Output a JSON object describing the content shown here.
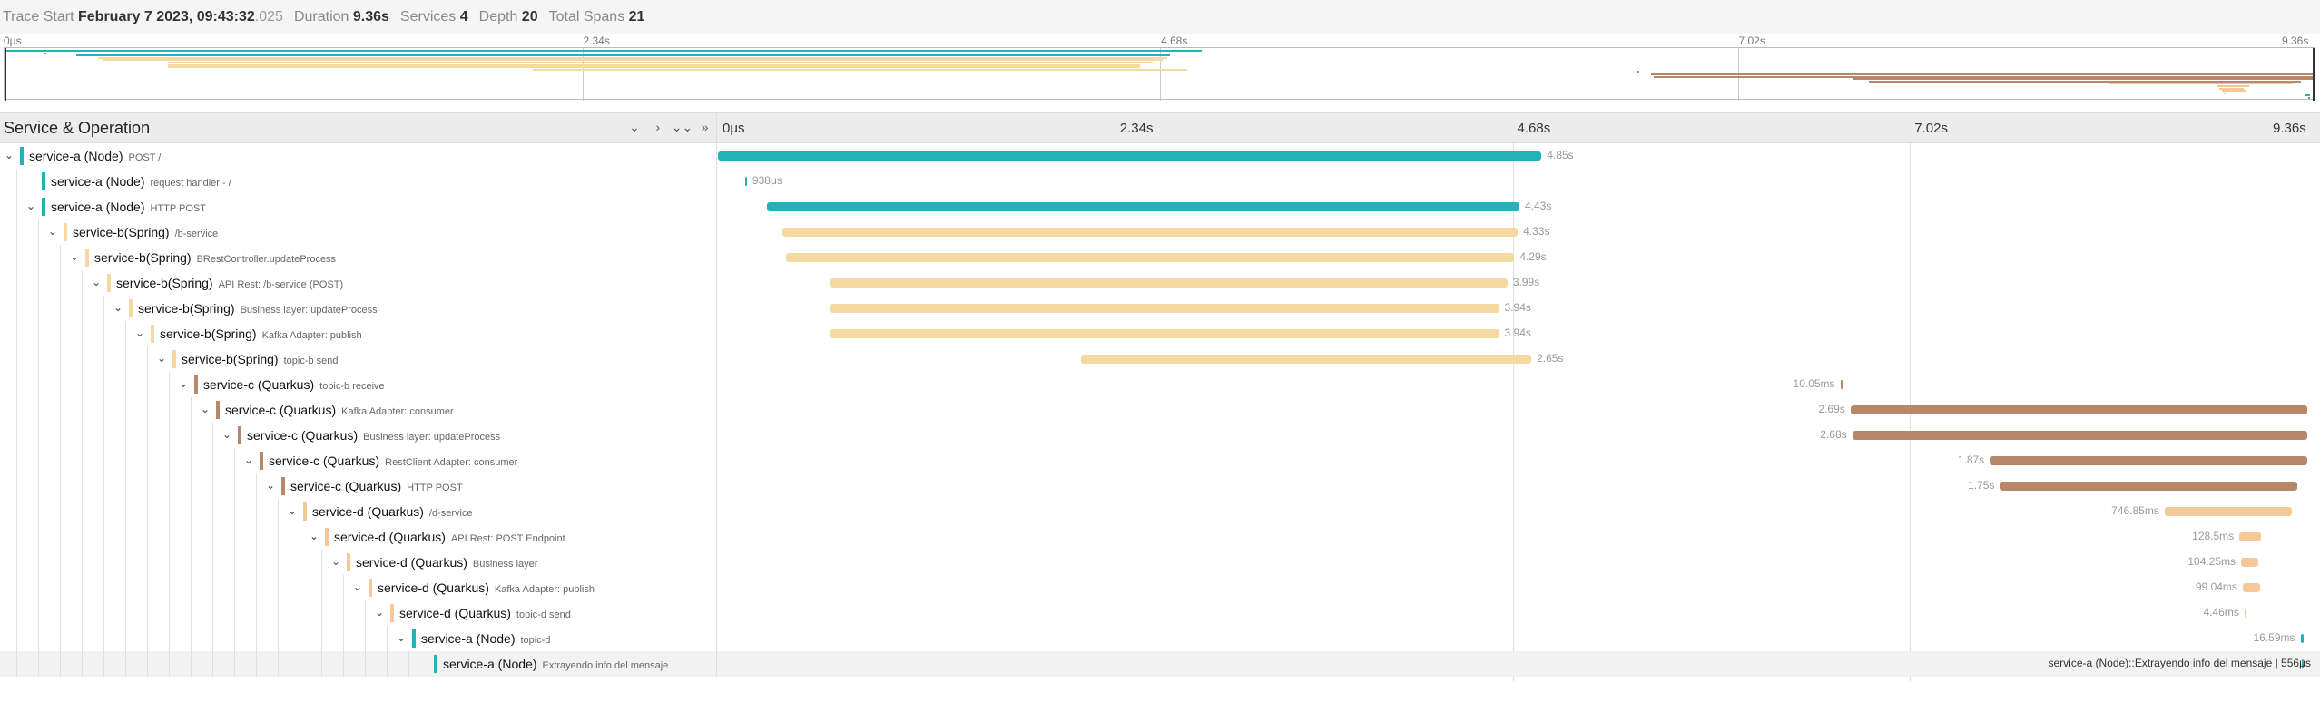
{
  "header": {
    "trace_start_label": "Trace Start",
    "trace_start_value": "February 7 2023, 09:43:32",
    "trace_start_ms": ".025",
    "duration_label": "Duration",
    "duration_value": "9.36s",
    "services_label": "Services",
    "services_value": "4",
    "depth_label": "Depth",
    "depth_value": "20",
    "spans_label": "Total Spans",
    "spans_value": "21"
  },
  "ticks": [
    "0μs",
    "2.34s",
    "4.68s",
    "7.02s",
    "9.36s"
  ],
  "table_head": {
    "title": "Service & Operation",
    "controls": [
      "⌄",
      "›",
      "⌄⌄",
      "»"
    ]
  },
  "colors": {
    "service-a": "#25b1b8",
    "service-b": "#f6d9a1",
    "service-c": "#b8876a",
    "service-d": "#f5c997"
  },
  "spans": [
    {
      "service": "service-a (Node)",
      "op": "POST /",
      "svc_key": "service-a",
      "depth": 0,
      "toggle": true,
      "start_s": 0.0,
      "dur_s": 4.85,
      "dur_label": "4.85s",
      "label_side": "right"
    },
    {
      "service": "service-a (Node)",
      "op": "request handler - /",
      "svc_key": "service-a",
      "depth": 1,
      "toggle": false,
      "start_s": 0.16,
      "dur_s": 0.0009,
      "dur_label": "938μs",
      "label_side": "right"
    },
    {
      "service": "service-a (Node)",
      "op": "HTTP POST",
      "svc_key": "service-a",
      "depth": 1,
      "toggle": true,
      "start_s": 0.29,
      "dur_s": 4.43,
      "dur_label": "4.43s",
      "label_side": "right"
    },
    {
      "service": "service-b(Spring)",
      "op": "/b-service",
      "svc_key": "service-b",
      "depth": 2,
      "toggle": true,
      "start_s": 0.38,
      "dur_s": 4.33,
      "dur_label": "4.33s",
      "label_side": "right"
    },
    {
      "service": "service-b(Spring)",
      "op": "BRestController.updateProcess",
      "svc_key": "service-b",
      "depth": 3,
      "toggle": true,
      "start_s": 0.4,
      "dur_s": 4.29,
      "dur_label": "4.29s",
      "label_side": "right"
    },
    {
      "service": "service-b(Spring)",
      "op": "API Rest: /b-service (POST)",
      "svc_key": "service-b",
      "depth": 4,
      "toggle": true,
      "start_s": 0.66,
      "dur_s": 3.99,
      "dur_label": "3.99s",
      "label_side": "right"
    },
    {
      "service": "service-b(Spring)",
      "op": "Business layer: updateProcess",
      "svc_key": "service-b",
      "depth": 5,
      "toggle": true,
      "start_s": 0.66,
      "dur_s": 3.94,
      "dur_label": "3.94s",
      "label_side": "right"
    },
    {
      "service": "service-b(Spring)",
      "op": "Kafka Adapter: publish",
      "svc_key": "service-b",
      "depth": 6,
      "toggle": true,
      "start_s": 0.66,
      "dur_s": 3.94,
      "dur_label": "3.94s",
      "label_side": "right"
    },
    {
      "service": "service-b(Spring)",
      "op": "topic-b send",
      "svc_key": "service-b",
      "depth": 7,
      "toggle": true,
      "start_s": 2.14,
      "dur_s": 2.65,
      "dur_label": "2.65s",
      "label_side": "right"
    },
    {
      "service": "service-c (Quarkus)",
      "op": "topic-b receive",
      "svc_key": "service-c",
      "depth": 8,
      "toggle": true,
      "start_s": 6.61,
      "dur_s": 0.01,
      "dur_label": "10.05ms",
      "label_side": "left"
    },
    {
      "service": "service-c (Quarkus)",
      "op": "Kafka Adapter: consumer",
      "svc_key": "service-c",
      "depth": 9,
      "toggle": true,
      "start_s": 6.67,
      "dur_s": 2.69,
      "dur_label": "2.69s",
      "label_side": "left"
    },
    {
      "service": "service-c (Quarkus)",
      "op": "Business layer: updateProcess",
      "svc_key": "service-c",
      "depth": 10,
      "toggle": true,
      "start_s": 6.68,
      "dur_s": 2.68,
      "dur_label": "2.68s",
      "label_side": "left"
    },
    {
      "service": "service-c (Quarkus)",
      "op": "RestClient Adapter: consumer",
      "svc_key": "service-c",
      "depth": 11,
      "toggle": true,
      "start_s": 7.49,
      "dur_s": 1.87,
      "dur_label": "1.87s",
      "label_side": "left"
    },
    {
      "service": "service-c (Quarkus)",
      "op": "HTTP POST",
      "svc_key": "service-c",
      "depth": 12,
      "toggle": true,
      "start_s": 7.55,
      "dur_s": 1.75,
      "dur_label": "1.75s",
      "label_side": "left"
    },
    {
      "service": "service-d (Quarkus)",
      "op": "/d-service",
      "svc_key": "service-d",
      "depth": 13,
      "toggle": true,
      "start_s": 8.52,
      "dur_s": 0.75,
      "dur_label": "746.85ms",
      "label_side": "left"
    },
    {
      "service": "service-d (Quarkus)",
      "op": "API Rest: POST Endpoint",
      "svc_key": "service-d",
      "depth": 14,
      "toggle": true,
      "start_s": 8.96,
      "dur_s": 0.13,
      "dur_label": "128.5ms",
      "label_side": "left"
    },
    {
      "service": "service-d (Quarkus)",
      "op": "Business layer",
      "svc_key": "service-d",
      "depth": 15,
      "toggle": true,
      "start_s": 8.97,
      "dur_s": 0.1,
      "dur_label": "104.25ms",
      "label_side": "left"
    },
    {
      "service": "service-d (Quarkus)",
      "op": "Kafka Adapter: publish",
      "svc_key": "service-d",
      "depth": 16,
      "toggle": true,
      "start_s": 8.98,
      "dur_s": 0.1,
      "dur_label": "99.04ms",
      "label_side": "left"
    },
    {
      "service": "service-d (Quarkus)",
      "op": "topic-d send",
      "svc_key": "service-d",
      "depth": 17,
      "toggle": true,
      "start_s": 8.99,
      "dur_s": 0.004,
      "dur_label": "4.46ms",
      "label_side": "left"
    },
    {
      "service": "service-a (Node)",
      "op": "topic-d",
      "svc_key": "service-a",
      "depth": 18,
      "toggle": true,
      "start_s": 9.32,
      "dur_s": 0.017,
      "dur_label": "16.59ms",
      "label_side": "left"
    },
    {
      "service": "service-a (Node)",
      "op": "Extrayendo info del mensaje",
      "svc_key": "service-a",
      "depth": 19,
      "toggle": false,
      "start_s": 9.33,
      "dur_s": 0.0006,
      "dur_label": "service-a (Node)::Extrayendo info del mensaje | 556μs",
      "label_side": "tip"
    }
  ],
  "total_s": 9.36
}
